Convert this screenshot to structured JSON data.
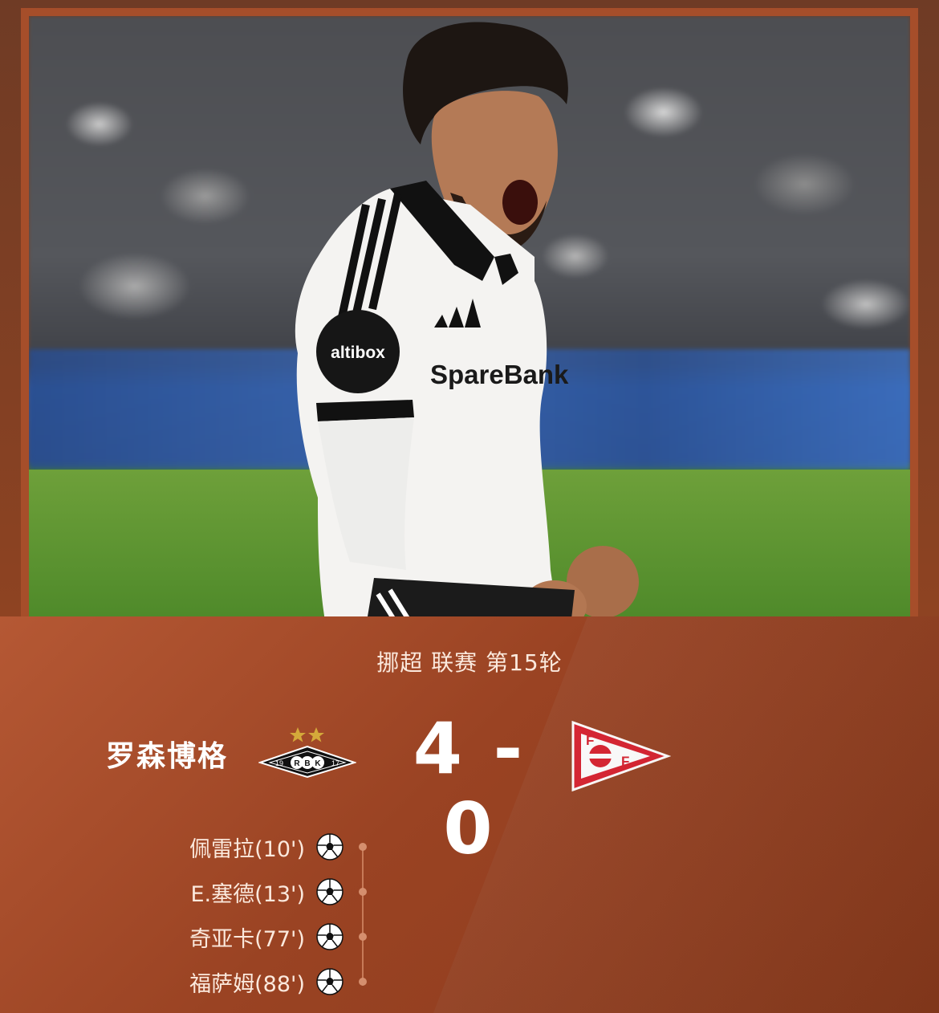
{
  "match": {
    "league": "挪超  联赛  第15轮",
    "home_team": "罗森博格",
    "home_badge_text": "RBK",
    "home_badge_years": [
      "19",
      "17"
    ],
    "score": "4 - 0",
    "away_team": "",
    "away_badge_letters": [
      "F",
      "F"
    ]
  },
  "scorers": [
    {
      "name": "佩雷拉(10')"
    },
    {
      "name": "E.塞德(13')"
    },
    {
      "name": "奇亚卡(77')"
    },
    {
      "name": "福萨姆(88')"
    }
  ],
  "photo": {
    "sponsor_sleeve": "altibox",
    "sponsor_chest": "SpareBank"
  },
  "colors": {
    "card_bg": "#9a4323",
    "frame": "#a64e2a",
    "away_red": "#d81e2c"
  }
}
